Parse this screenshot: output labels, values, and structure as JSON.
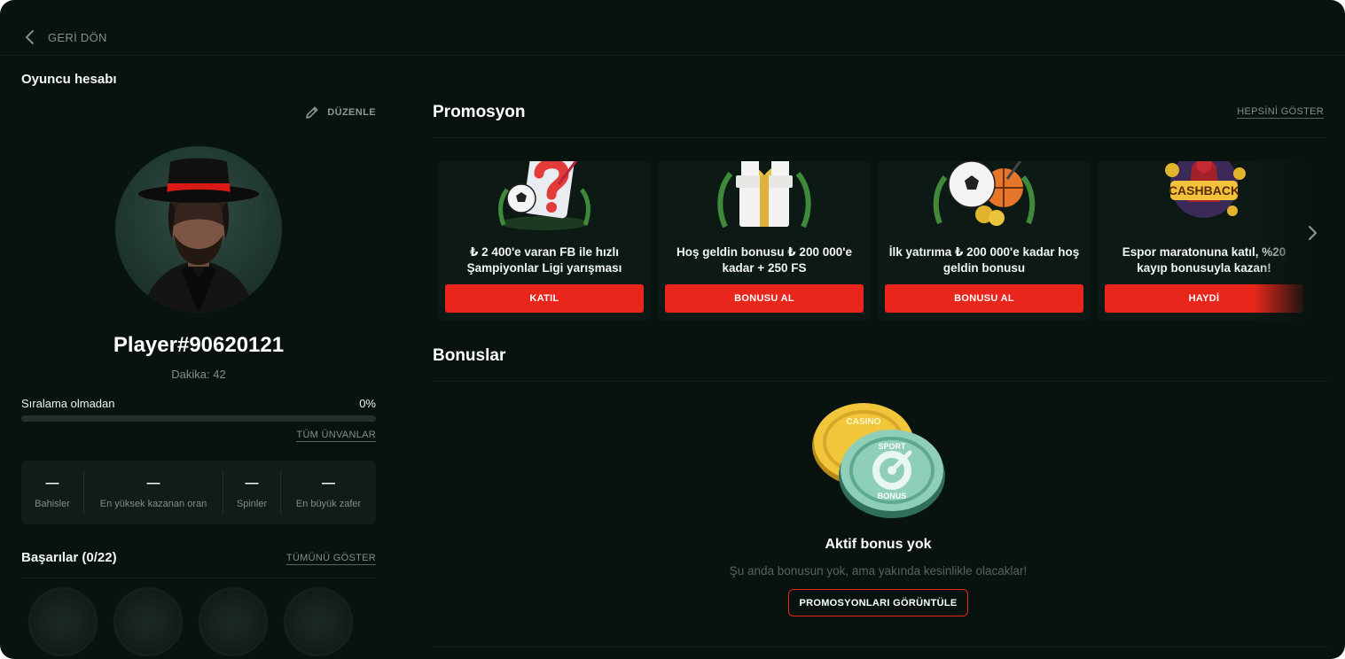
{
  "nav": {
    "back_label": "GERİ DÖN",
    "back_icon": "chevron-left-icon"
  },
  "profile": {
    "section_title": "Oyuncu hesabı",
    "edit_label": "DÜZENLE",
    "edit_icon": "pencil-icon",
    "player_name": "Player#90620121",
    "minutes": "Dakika: 42",
    "rank_label": "Sıralama olmadan",
    "rank_percent_text": "0%",
    "rank_progress": 0,
    "all_titles_link": "TÜM ÜNVANLAR",
    "stats": [
      {
        "value": "—",
        "label": "Bahisler"
      },
      {
        "value": "—",
        "label": "En yüksek kazanan oran"
      },
      {
        "value": "—",
        "label": "Spinler"
      },
      {
        "value": "—",
        "label": "En büyük zafer"
      }
    ]
  },
  "achievements": {
    "title": "Başarılar (0/22)",
    "show_all_link": "TÜMÜNÜ GÖSTER",
    "badges": [
      "ball-badge-icon",
      "racket-badge-icon",
      "chip-badge-icon",
      "trophy-badge-icon"
    ]
  },
  "promotions": {
    "title": "Promosyon",
    "show_all_link": "HEPSİNİ GÖSTER",
    "cards": [
      {
        "image": "football-question-icon",
        "text": "₺ 2 400'e varan FB ile hızlı Şampiyonlar Ligi yarışması",
        "button": "KATIL"
      },
      {
        "image": "gift-box-icon",
        "text": "Hoş geldin bonusu ₺ 200 000'e kadar + 250 FS",
        "button": "BONUSU AL"
      },
      {
        "image": "sports-balls-icon",
        "text": "İlk yatırıma ₺ 200 000'e kadar hoş geldin bonusu",
        "button": "BONUSU AL"
      },
      {
        "image": "cashback-icon",
        "text": "Espor maratonuna katıl, %20 kayıp bonusuyla kazan!",
        "button": "HAYDİ"
      }
    ],
    "next_icon": "chevron-right-icon"
  },
  "bonuses": {
    "title": "Bonuslar",
    "coins_icon": "casino-sport-coins-icon",
    "coin_text_top": "CASINO",
    "coin_text_front": "SPORT",
    "coin_text_bottom": "BONUS",
    "empty_title": "Aktif bonus yok",
    "empty_sub": "Şu anda bonusun yok, ama yakında kesinlikle olacaklar!",
    "view_promos_button": "PROMOSYONLARI GÖRÜNTÜLE"
  },
  "colors": {
    "background": "#08130f",
    "accent": "#e8261b",
    "muted": "#7f8f88",
    "card": "#0d1914"
  }
}
